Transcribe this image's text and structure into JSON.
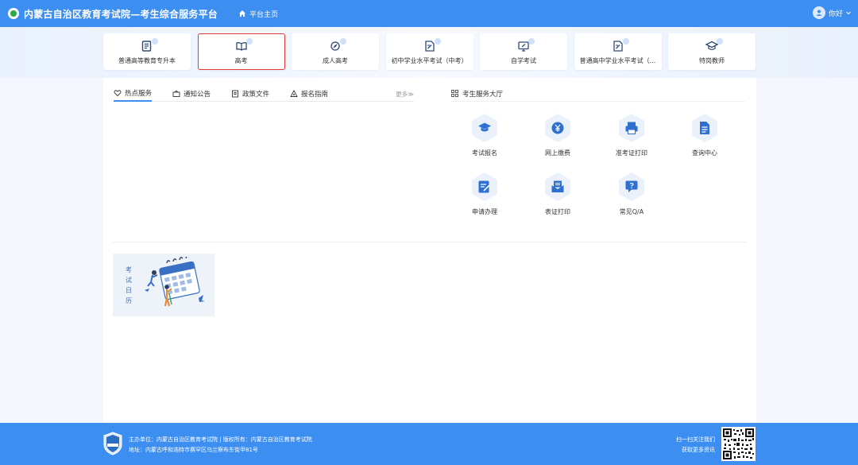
{
  "header": {
    "site_title": "内蒙古自治区教育考试院—考生综合服务平台",
    "home_label": "平台主页",
    "user_label": "你好"
  },
  "categories": [
    {
      "label": "普通高等教育专升本",
      "icon": "document-list-icon",
      "active": false
    },
    {
      "label": "高考",
      "icon": "open-book-icon",
      "active": true
    },
    {
      "label": "成人高考",
      "icon": "pen-badge-icon",
      "active": false
    },
    {
      "label": "初中学业水平考试（中考）",
      "icon": "edit-document-icon",
      "active": false
    },
    {
      "label": "自学考试",
      "icon": "monitor-edit-icon",
      "active": false
    },
    {
      "label": "普通高中学业水平考试（...",
      "icon": "edit-document-icon",
      "active": false
    },
    {
      "label": "特岗教师",
      "icon": "graduation-cap-icon",
      "active": false
    }
  ],
  "tabs": [
    {
      "label": "热点服务",
      "icon": "heart-icon"
    },
    {
      "label": "通知公告",
      "icon": "notice-icon"
    },
    {
      "label": "政策文件",
      "icon": "file-icon"
    },
    {
      "label": "报名指南",
      "icon": "guide-icon"
    }
  ],
  "tabs_more": "更多≫",
  "service_hall": {
    "title": "考生服务大厅",
    "items": [
      {
        "label": "考试报名",
        "icon": "graduation-cap-icon"
      },
      {
        "label": "网上缴费",
        "icon": "yuan-payment-icon"
      },
      {
        "label": "准考证打印",
        "icon": "printer-icon"
      },
      {
        "label": "查询中心",
        "icon": "search-document-icon"
      },
      {
        "label": "申请办理",
        "icon": "application-edit-icon"
      },
      {
        "label": "表证打印",
        "icon": "mail-print-icon"
      },
      {
        "label": "常见Q/A",
        "icon": "chat-question-icon"
      }
    ]
  },
  "calendar_card": {
    "chars": [
      "考",
      "试",
      "日",
      "历"
    ]
  },
  "footer": {
    "line1": "主办单位：内蒙古自治区教育考试院 | 版权所有：内蒙古自治区教育考试院",
    "line2": "地址：内蒙古呼和浩特市赛罕区乌兰察布东街甲81号",
    "qr_line1": "扫一扫关注我们",
    "qr_line2": "获取更多资讯"
  },
  "colors": {
    "primary": "#3c8ef0",
    "active_border": "#e33c36",
    "icon_blue": "#2f6fd0"
  }
}
